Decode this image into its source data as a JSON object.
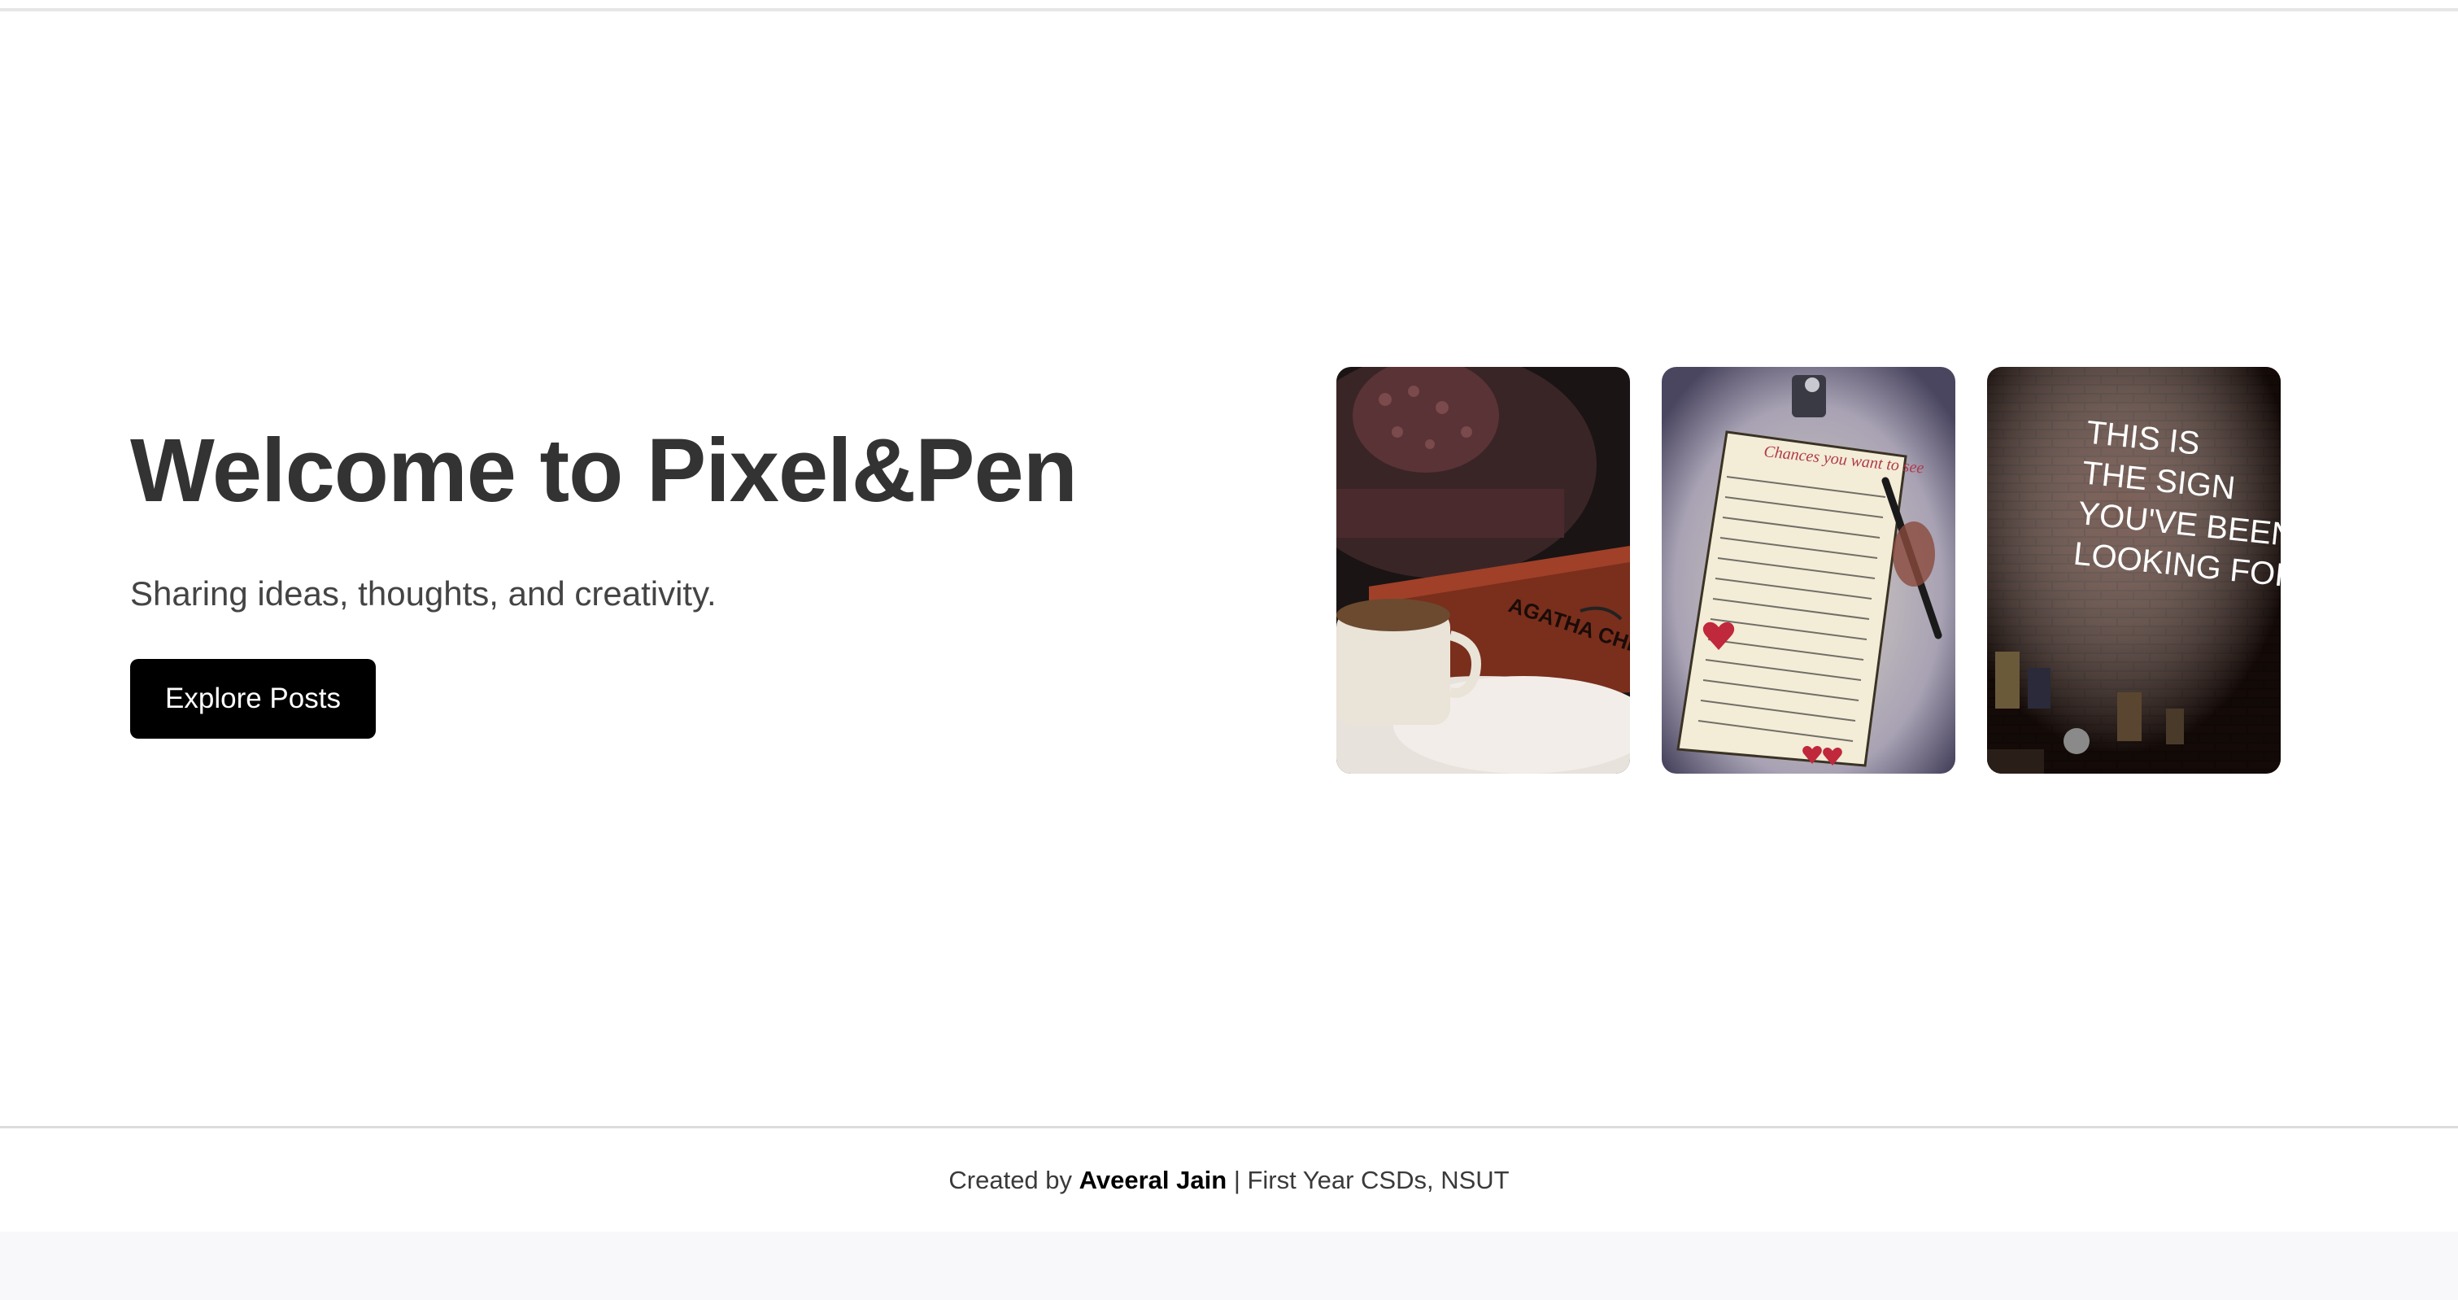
{
  "hero": {
    "title": "Welcome to Pixel&Pen",
    "subtitle": "Sharing ideas, thoughts, and creativity.",
    "cta_label": "Explore Posts"
  },
  "gallery": {
    "photo1": {
      "book_text": "AGATHA CHRISTIE"
    },
    "photo2": {
      "heading": "Chances you want to see"
    },
    "photo3": {
      "neon_lines": [
        "THIS IS",
        "THE SIGN",
        "YOU'VE BEEN",
        "LOOKING FOR"
      ]
    }
  },
  "footer": {
    "prefix": "Created by",
    "author": "Aveeral Jain",
    "suffix": "| First Year CSDs, NSUT"
  },
  "colors": {
    "button_bg": "#000000",
    "title": "#333333",
    "page_bg": "#ffffff",
    "bottom_bg": "#f8f8fa"
  }
}
